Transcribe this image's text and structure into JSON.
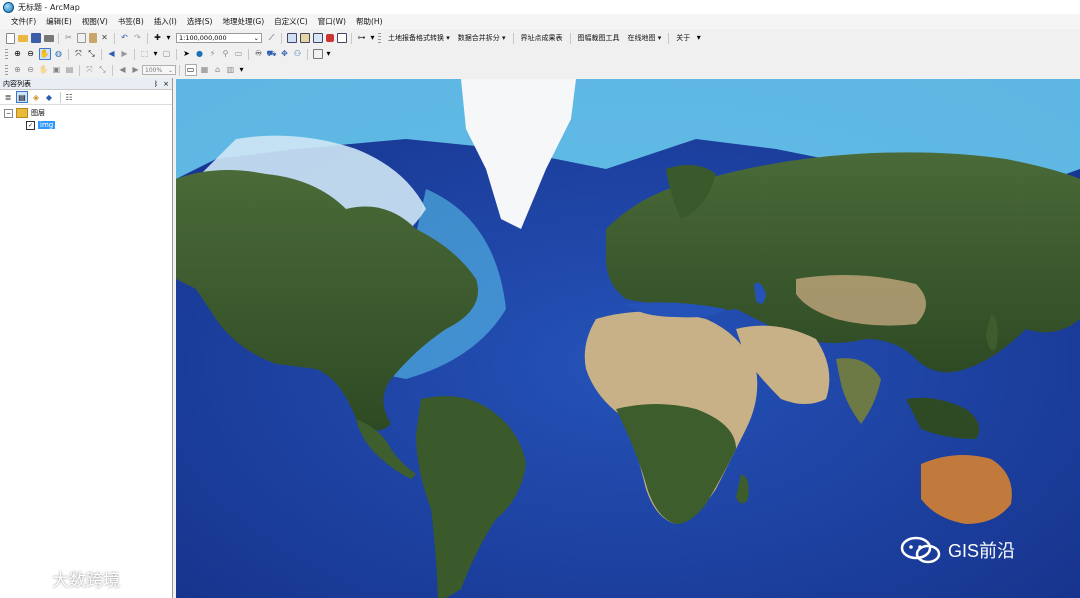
{
  "window": {
    "title": "无标题 - ArcMap"
  },
  "menu": [
    "文件(F)",
    "编辑(E)",
    "视图(V)",
    "书签(B)",
    "插入(I)",
    "选择(S)",
    "地理处理(G)",
    "自定义(C)",
    "窗口(W)",
    "帮助(H)"
  ],
  "toolbar": {
    "scale_value": "1:100,000,000",
    "addin_labels": [
      "土地报备格式转换",
      "数据合并拆分",
      "界址点成果表",
      "图幅裁图工具",
      "在线地图",
      "关于"
    ],
    "zoom_value": "100%"
  },
  "toc": {
    "title": "内容列表",
    "pin": "ᛒ",
    "close": "×",
    "group_label": "图层",
    "layer_label": "img"
  },
  "watermarks": {
    "left_text": "大数跨境",
    "right_text": "GIS前沿"
  },
  "colors": {
    "ocean_deep": "#1a3f9e",
    "ocean_shelf": "#5fc6ee",
    "land_green": "#3f5e2e",
    "desert": "#c9b187",
    "ice": "#f5f7f8",
    "selection": "#3399ff"
  }
}
